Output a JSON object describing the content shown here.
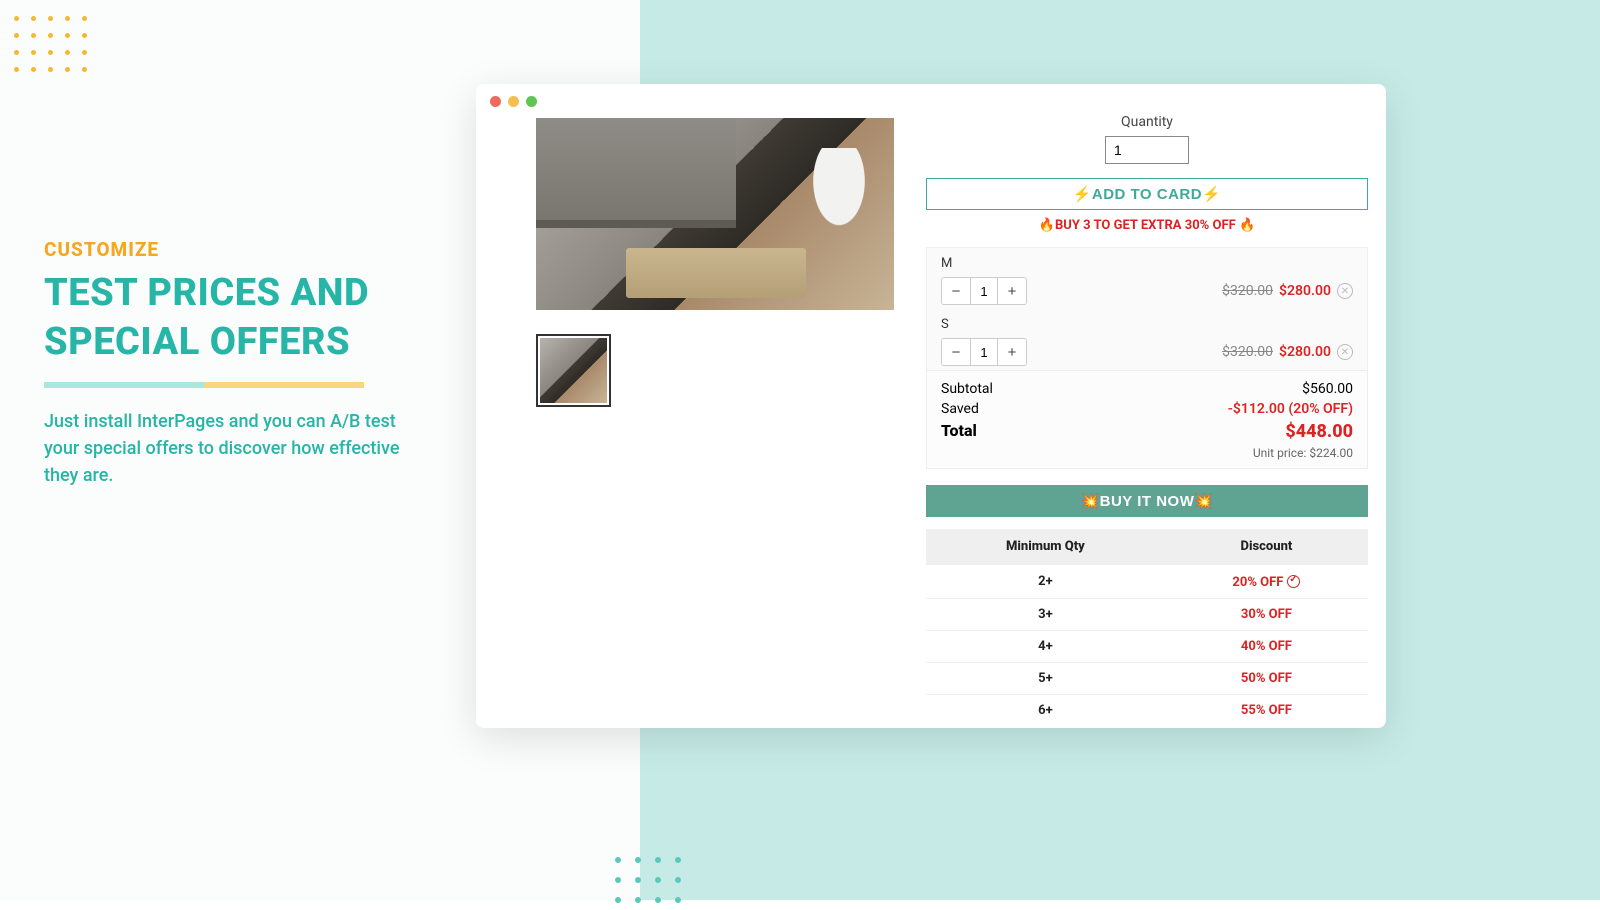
{
  "marketing": {
    "eyebrow": "CUSTOMIZE",
    "title": "TEST PRICES AND SPECIAL OFFERS",
    "description": "Just install InterPages and you can A/B test your special offers to discover how effective they are."
  },
  "product": {
    "quantity_label": "Quantity",
    "quantity_value": "1",
    "add_to_cart": "⚡ADD TO CARD⚡",
    "promo": "🔥BUY 3 TO GET EXTRA 30% OFF 🔥",
    "buy_now": "💥BUY IT NOW💥"
  },
  "cart": {
    "items": [
      {
        "variant": "M",
        "qty": "1",
        "old": "$320.00",
        "new": "$280.00"
      },
      {
        "variant": "S",
        "qty": "1",
        "old": "$320.00",
        "new": "$280.00"
      }
    ],
    "subtotal_label": "Subtotal",
    "subtotal_value": "$560.00",
    "saved_label": "Saved",
    "saved_value": "-$112.00 (20% OFF)",
    "total_label": "Total",
    "total_value": "$448.00",
    "unit_label": "Unit price:",
    "unit_value": "$224.00"
  },
  "discount_table": {
    "headers": {
      "qty": "Minimum Qty",
      "disc": "Discount"
    },
    "rows": [
      {
        "qty": "2+",
        "disc": "20% OFF",
        "active": true
      },
      {
        "qty": "3+",
        "disc": "30% OFF"
      },
      {
        "qty": "4+",
        "disc": "40% OFF"
      },
      {
        "qty": "5+",
        "disc": "50% OFF"
      },
      {
        "qty": "6+",
        "disc": "55% OFF"
      }
    ]
  }
}
